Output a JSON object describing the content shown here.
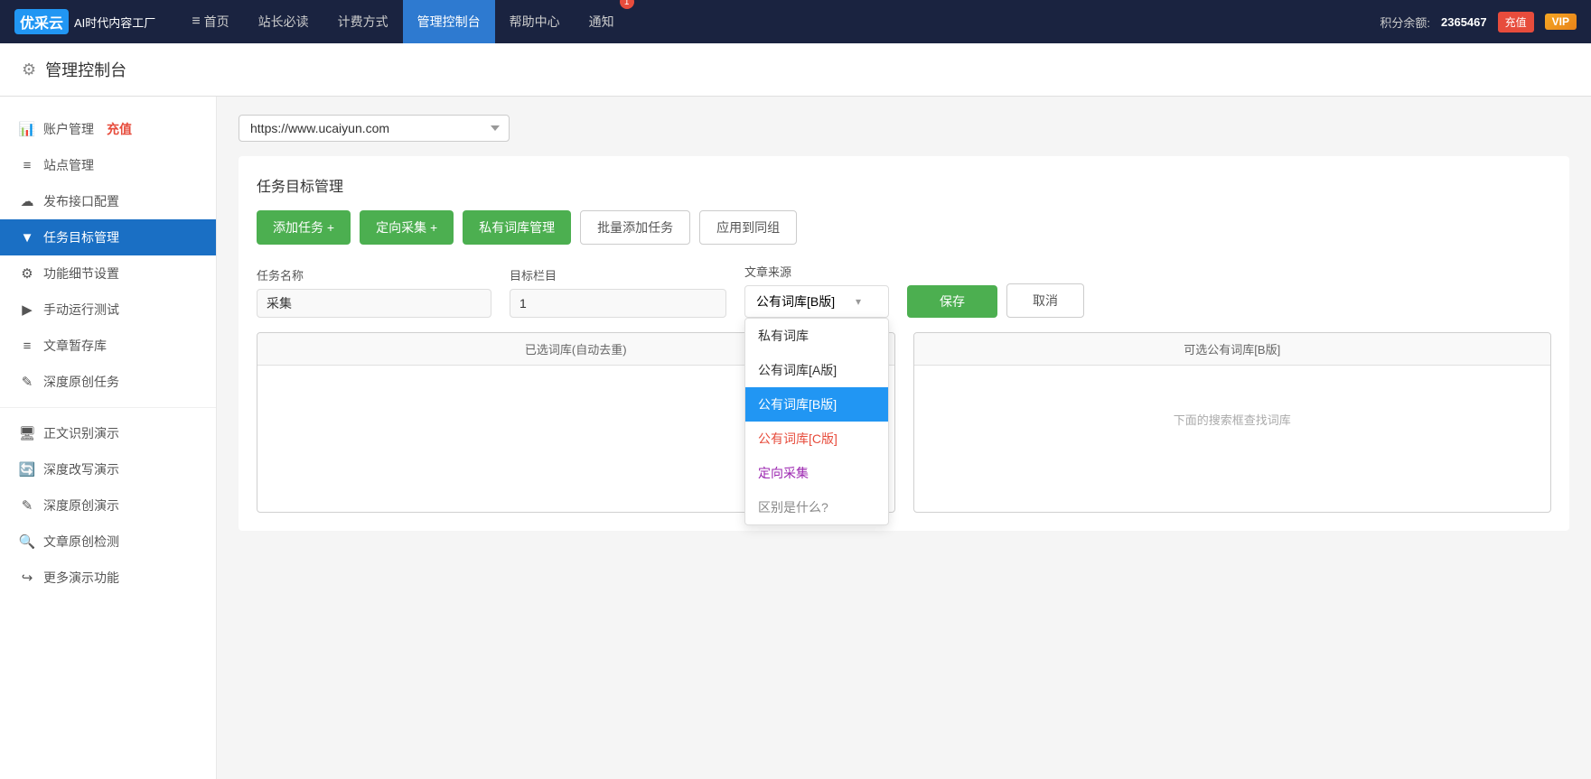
{
  "topnav": {
    "logo_short": "优采云",
    "logo_sub": "AI时代内容工厂",
    "nav_items": [
      {
        "id": "home",
        "label": "首页",
        "icon": "≡",
        "active": false
      },
      {
        "id": "must-read",
        "label": "站长必读",
        "active": false
      },
      {
        "id": "pricing",
        "label": "计费方式",
        "active": false
      },
      {
        "id": "console",
        "label": "管理控制台",
        "active": true
      },
      {
        "id": "help",
        "label": "帮助中心",
        "active": false
      },
      {
        "id": "notify",
        "label": "通知",
        "active": false,
        "badge": "1"
      }
    ],
    "points_label": "积分余额:",
    "points_value": "2365467",
    "topup_label": "充值",
    "vip_label": "VIP"
  },
  "page_header": {
    "title": "管理控制台"
  },
  "sidebar": {
    "items": [
      {
        "id": "account",
        "label": "账户管理",
        "icon": "📊",
        "has_recharge": true,
        "recharge_label": "充值"
      },
      {
        "id": "site",
        "label": "站点管理",
        "icon": "≡"
      },
      {
        "id": "publish",
        "label": "发布接口配置",
        "icon": "☁"
      },
      {
        "id": "task",
        "label": "任务目标管理",
        "icon": "▼",
        "active": true
      },
      {
        "id": "settings",
        "label": "功能细节设置",
        "icon": "⚙"
      },
      {
        "id": "manual",
        "label": "手动运行测试",
        "icon": "▶"
      },
      {
        "id": "draft",
        "label": "文章暂存库",
        "icon": "≡"
      },
      {
        "id": "original",
        "label": "深度原创任务",
        "icon": "✎"
      }
    ],
    "demo_items": [
      {
        "id": "ocr",
        "label": "正文识别演示",
        "icon": "🖥"
      },
      {
        "id": "rewrite",
        "label": "深度改写演示",
        "icon": "🔄"
      },
      {
        "id": "orig-demo",
        "label": "深度原创演示",
        "icon": "✎"
      },
      {
        "id": "check",
        "label": "文章原创检测",
        "icon": "🔍"
      },
      {
        "id": "more",
        "label": "更多演示功能",
        "icon": "↪"
      }
    ]
  },
  "site_selector": {
    "value": "https://www.ucaiyun.com",
    "options": [
      "https://www.ucaiyun.com"
    ]
  },
  "task_section": {
    "title": "任务目标管理",
    "btn_add_task": "添加任务 +",
    "btn_directed": "定向采集 +",
    "btn_private_lib": "私有词库管理",
    "btn_batch_add": "批量添加任务",
    "btn_apply_group": "应用到同组",
    "form": {
      "task_name_label": "任务名称",
      "task_name_value": "采集",
      "target_col_label": "目标栏目",
      "target_col_value": "1",
      "source_label": "文章来源",
      "source_value": "公有词库[B版]"
    },
    "btn_save": "保存",
    "btn_cancel": "取消",
    "dropdown": {
      "options": [
        {
          "id": "private",
          "label": "私有词库",
          "style": "normal"
        },
        {
          "id": "public-a",
          "label": "公有词库[A版]",
          "style": "normal"
        },
        {
          "id": "public-b",
          "label": "公有词库[B版]",
          "style": "selected"
        },
        {
          "id": "public-c",
          "label": "公有词库[C版]",
          "style": "c-version"
        },
        {
          "id": "directed",
          "label": "定向采集",
          "style": "directed"
        },
        {
          "id": "diff",
          "label": "区别是什么?",
          "style": "diff"
        }
      ]
    },
    "wordlib_left_header": "已选词库(自动去重)",
    "wordlib_right_header": "可选公有词库[B版]",
    "wordlib_right_hint": "下面的搜索框查找词库"
  }
}
